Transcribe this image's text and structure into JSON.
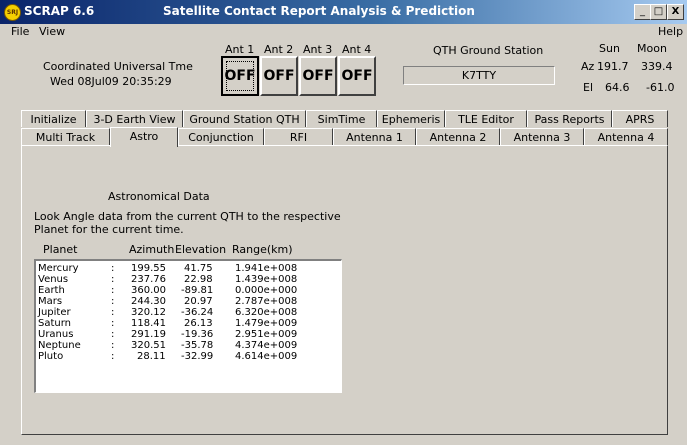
{
  "window": {
    "app_icon_text": "SRJ",
    "app_title": "SCRAP  6.6",
    "title": "Satellite Contact Report Analysis & Prediction",
    "minimize": "_",
    "maximize": "□",
    "close": "X"
  },
  "menu": {
    "file": "File",
    "view": "View",
    "help": "Help"
  },
  "utc": {
    "label": "Coordinated Universal Tme",
    "value": "Wed 08Jul09 20:35:29"
  },
  "antennas": [
    {
      "label": "Ant 1",
      "state": "OFF"
    },
    {
      "label": "Ant 2",
      "state": "OFF"
    },
    {
      "label": "Ant 3",
      "state": "OFF"
    },
    {
      "label": "Ant 4",
      "state": "OFF"
    }
  ],
  "qth": {
    "label": "QTH Ground Station",
    "callsign": "K7TTY"
  },
  "sunmoon": {
    "sun_label": "Sun",
    "moon_label": "Moon",
    "az_label": "Az",
    "el_label": "El",
    "sun_az": "191.7",
    "moon_az": "339.4",
    "sun_el": "64.6",
    "moon_el": "-61.0"
  },
  "tabs_row1": [
    "Initialize",
    "3-D Earth View",
    "Ground Station QTH",
    "SimTime",
    "Ephemeris",
    "TLE Editor",
    "Pass Reports",
    "APRS"
  ],
  "tabs_row2": [
    "Multi Track",
    "Astro",
    "Conjunction",
    "RFI",
    "Antenna 1",
    "Antenna 2",
    "Antenna 3",
    "Antenna 4"
  ],
  "astro": {
    "heading": "Astronomical Data",
    "desc_line1": "Look Angle data from the current QTH to the respective",
    "desc_line2": "Planet for the current time.",
    "col_planet": "Planet",
    "col_azimuth": "Azimuth",
    "col_elevation": "Elevation",
    "col_range": "Range(km)",
    "rows": [
      {
        "planet": "Mercury",
        "sep": ":",
        "az": "199.55",
        "el": "41.75",
        "range": "1.941e+008"
      },
      {
        "planet": "Venus",
        "sep": ":",
        "az": "237.76",
        "el": "22.98",
        "range": "1.439e+008"
      },
      {
        "planet": "Earth",
        "sep": ":",
        "az": "360.00",
        "el": "-89.81",
        "range": "0.000e+000"
      },
      {
        "planet": "Mars",
        "sep": ":",
        "az": "244.30",
        "el": "20.97",
        "range": "2.787e+008"
      },
      {
        "planet": "Jupiter",
        "sep": ":",
        "az": "320.12",
        "el": "-36.24",
        "range": "6.320e+008"
      },
      {
        "planet": "Saturn",
        "sep": ":",
        "az": "118.41",
        "el": "26.13",
        "range": "1.479e+009"
      },
      {
        "planet": "Uranus",
        "sep": ":",
        "az": "291.19",
        "el": "-19.36",
        "range": "2.951e+009"
      },
      {
        "planet": "Neptune",
        "sep": ":",
        "az": "320.51",
        "el": "-35.78",
        "range": "4.374e+009"
      },
      {
        "planet": "Pluto",
        "sep": ":",
        "az": "28.11",
        "el": "-32.99",
        "range": "4.614e+009"
      }
    ]
  }
}
